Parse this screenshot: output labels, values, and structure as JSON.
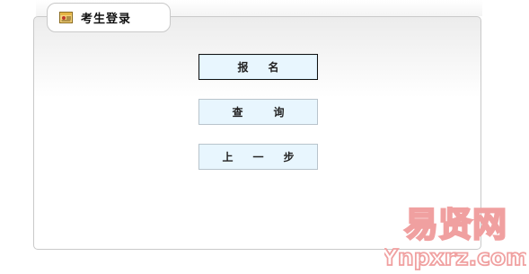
{
  "panel": {
    "title": "考生登录",
    "icon": "id-card-icon"
  },
  "menu": [
    {
      "label": "报  名",
      "chars": [
        "报",
        "名"
      ],
      "active": true,
      "name": "register-button"
    },
    {
      "label": "查  询",
      "chars": [
        "查",
        "询"
      ],
      "active": false,
      "name": "query-button"
    },
    {
      "label": "上 一 步",
      "chars": [
        "上",
        "一",
        "步"
      ],
      "active": false,
      "name": "previous-step-button"
    }
  ],
  "watermark": {
    "title": "易贤网",
    "subtitle": "Ynpxrz.com"
  },
  "colors": {
    "button_bg": "#e8f6fe",
    "button_border": "#b8c4cc",
    "active_border": "#111111",
    "panel_border": "#c9c9c9",
    "watermark": "#f0a0a0"
  }
}
